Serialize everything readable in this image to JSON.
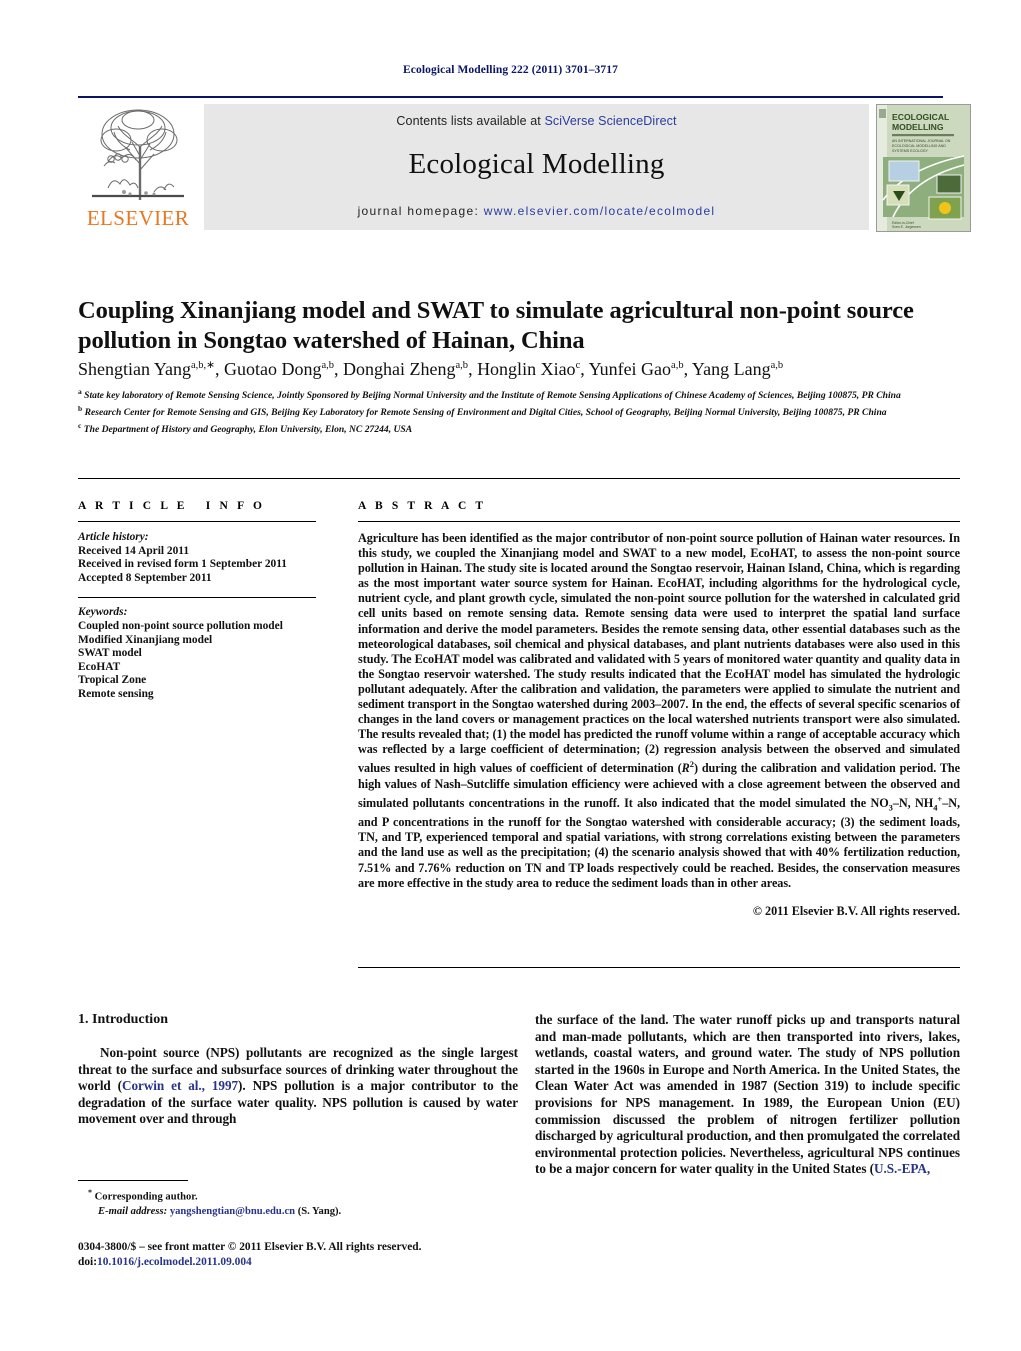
{
  "running_head": "Ecological Modelling 222 (2011) 3701–3717",
  "masthead": {
    "contents_prefix": "Contents lists available at ",
    "contents_link": "SciVerse ScienceDirect",
    "journal_name": "Ecological Modelling",
    "homepage_prefix": "journal homepage: ",
    "homepage_url": "www.elsevier.com/locate/ecolmodel",
    "publisher": "ELSEVIER",
    "cover_title_line1": "ECOLOGICAL",
    "cover_title_line2": "MODELLING",
    "colors": {
      "rule_navy": "#0a1466",
      "link_blue": "#2a3c9e",
      "elsevier_orange": "#e87722",
      "grey_box": "#e7e7e7"
    }
  },
  "article": {
    "title": "Coupling Xinanjiang model and SWAT to simulate agricultural non-point source pollution in Songtao watershed of Hainan, China",
    "authors_html": "Shengtian Yang<sup>a,b,∗</sup>, Guotao Dong<sup>a,b</sup>, Donghai Zheng<sup>a,b</sup>, Honglin Xiao<sup>c</sup>, Yunfei Gao<sup>a,b</sup>, Yang Lang<sup>a,b</sup>",
    "affiliations": [
      "State key laboratory of Remote Sensing Science, Jointly Sponsored by Beijing Normal University and the Institute of Remote Sensing Applications of Chinese Academy of Sciences, Beijing 100875, PR China",
      "Research Center for Remote Sensing and GIS, Beijing Key Laboratory for Remote Sensing of Environment and Digital Cities, School of Geography, Beijing Normal University, Beijing 100875, PR China",
      "The Department of History and Geography, Elon University, Elon, NC 27244, USA"
    ],
    "affiliation_marks": [
      "a",
      "b",
      "c"
    ]
  },
  "article_info": {
    "heading": "ARTICLE INFO",
    "history_label": "Article history:",
    "history": [
      "Received 14 April 2011",
      "Received in revised form 1 September 2011",
      "Accepted 8 September 2011"
    ],
    "keywords_label": "Keywords:",
    "keywords": [
      "Coupled non-point source pollution model",
      "Modified Xinanjiang model",
      "SWAT model",
      "EcoHAT",
      "Tropical Zone",
      "Remote sensing"
    ]
  },
  "abstract": {
    "heading": "ABSTRACT",
    "text_html": "Agriculture has been identified as the major contributor of non-point source pollution of Hainan water resources. In this study, we coupled the Xinanjiang model and SWAT to a new model, EcoHAT, to assess the non-point source pollution in Hainan. The study site is located around the Songtao reservoir, Hainan Island, China, which is regarding as the most important water source system for Hainan. EcoHAT, including algorithms for the hydrological cycle, nutrient cycle, and plant growth cycle, simulated the non-point source pollution for the watershed in calculated grid cell units based on remote sensing data. Remote sensing data were used to interpret the spatial land surface information and derive the model parameters. Besides the remote sensing data, other essential databases such as the meteorological databases, soil chemical and physical databases, and plant nutrients databases were also used in this study. The EcoHAT model was calibrated and validated with 5 years of monitored water quantity and quality data in the Songtao reservoir watershed. The study results indicated that the EcoHAT model has simulated the hydrologic pollutant adequately. After the calibration and validation, the parameters were applied to simulate the nutrient and sediment transport in the Songtao watershed during 2003–2007. In the end, the effects of several specific scenarios of changes in the land covers or management practices on the local watershed nutrients transport were also simulated. The results revealed that; (1) the model has predicted the runoff volume within a range of acceptable accuracy which was reflected by a large coefficient of determination; (2) regression analysis between the observed and simulated values resulted in high values of coefficient of determination (<i>R</i><sup>2</sup>) during the calibration and validation period. The high values of Nash–Sutcliffe simulation efficiency were achieved with a close agreement between the observed and simulated pollutants concentrations in the runoff. It also indicated that the model simulated the NO<sub>3</sub>–N, NH<sub>4</sub><sup>+</sup>–N, and P concentrations in the runoff for the Songtao watershed with considerable accuracy; (3) the sediment loads, TN, and TP, experienced temporal and spatial variations, with strong correlations existing between the parameters and the land use as well as the precipitation; (4) the scenario analysis showed that with 40% fertilization reduction, 7.51% and 7.76% reduction on TN and TP loads respectively could be reached. Besides, the conservation measures are more effective in the study area to reduce the sediment loads than in other areas.",
    "copyright": "© 2011 Elsevier B.V. All rights reserved."
  },
  "introduction": {
    "section_number_title": "1.  Introduction",
    "left_paragraph_html": "Non-point source (NPS) pollutants are recognized as the single largest threat to the surface and subsurface sources of drinking water throughout the world (<span class=\"ref\">Corwin et al., 1997</span>). NPS pollution is a major contributor to the degradation of the surface water quality. NPS pollution is caused by water movement over and through",
    "right_paragraph_html": "the surface of the land. The water runoff picks up and transports natural and man-made pollutants, which are then transported into rivers, lakes, wetlands, coastal waters, and ground water. The study of NPS pollution started in the 1960s in Europe and North America. In the United States, the Clean Water Act was amended in 1987 (Section 319) to include specific provisions for NPS management. In 1989, the European Union (EU) commission discussed the problem of nitrogen fertilizer pollution discharged by agricultural production, and then promulgated the correlated environmental protection policies. Nevertheless, agricultural NPS continues to be a major concern for water quality in the United States (<span class=\"ref\">U.S.-EPA,</span>"
  },
  "footer": {
    "corresponding_author": "Corresponding author.",
    "email_label": "E-mail address:",
    "email": "yangshengtian@bnu.edu.cn",
    "email_suffix": "(S. Yang).",
    "issn_line": "0304-3800/$ – see front matter © 2011 Elsevier B.V. All rights reserved.",
    "doi_label": "doi:",
    "doi": "10.1016/j.ecolmodel.2011.09.004"
  }
}
